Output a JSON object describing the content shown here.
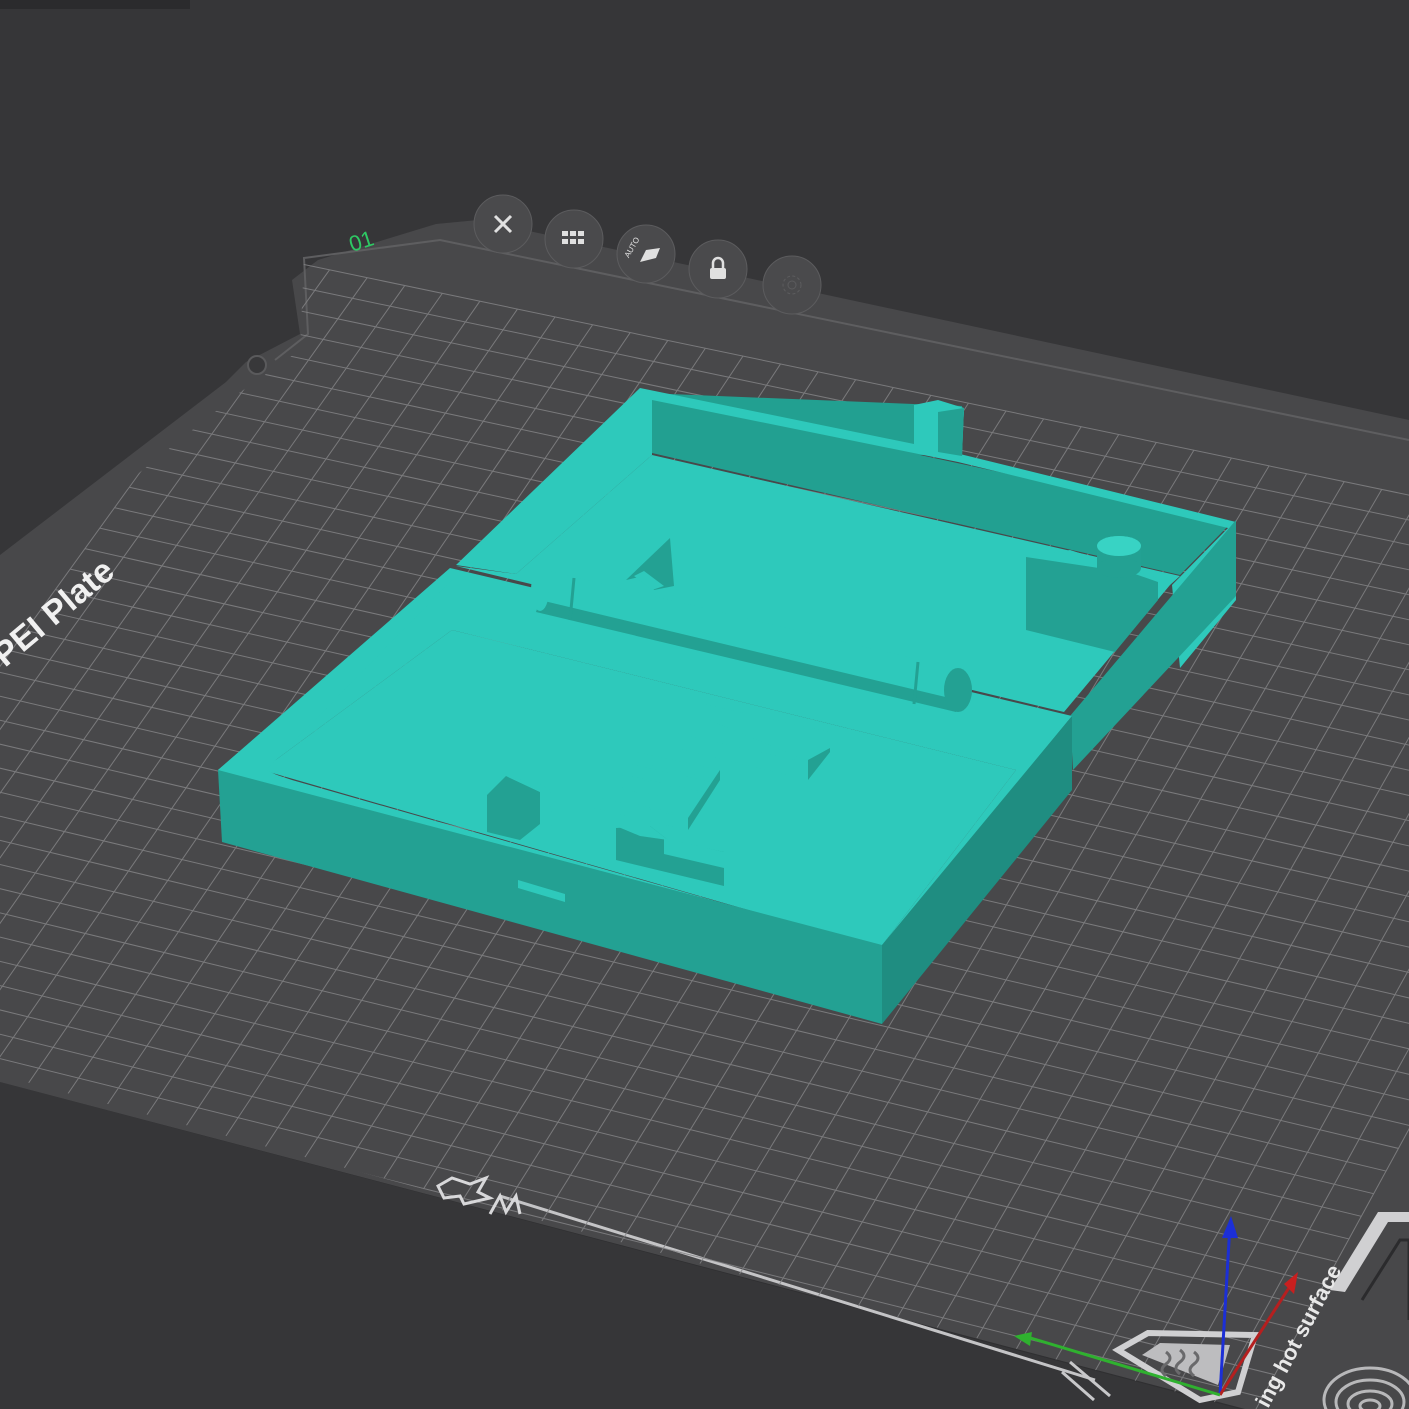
{
  "plate": {
    "number": "01",
    "label": "Textured PEI Plate",
    "label_visible": "PEI Plate",
    "warning": "Caution: heating hot surface",
    "warning_visible": "ing hot surface"
  },
  "plate_toolbar": [
    {
      "name": "remove-plate-button",
      "icon": "close-icon"
    },
    {
      "name": "arrange-plate-button",
      "icon": "arrange-icon"
    },
    {
      "name": "auto-orient-button",
      "icon": "auto-orient-icon",
      "text": "AUTO"
    },
    {
      "name": "lock-plate-button",
      "icon": "lock-icon"
    },
    {
      "name": "plate-settings-button",
      "icon": "gear-icon"
    }
  ],
  "colors": {
    "background": "#363638",
    "plate": "#48484a",
    "grid": "#8a8a8c",
    "model_top": "#2ec9bb",
    "model_side": "#23a193",
    "model_shadow": "#1f8d81",
    "accent_green": "#2ec964",
    "axis_x": "#d21f1f",
    "axis_y": "#2fb12f",
    "axis_z": "#1c2fd6"
  }
}
